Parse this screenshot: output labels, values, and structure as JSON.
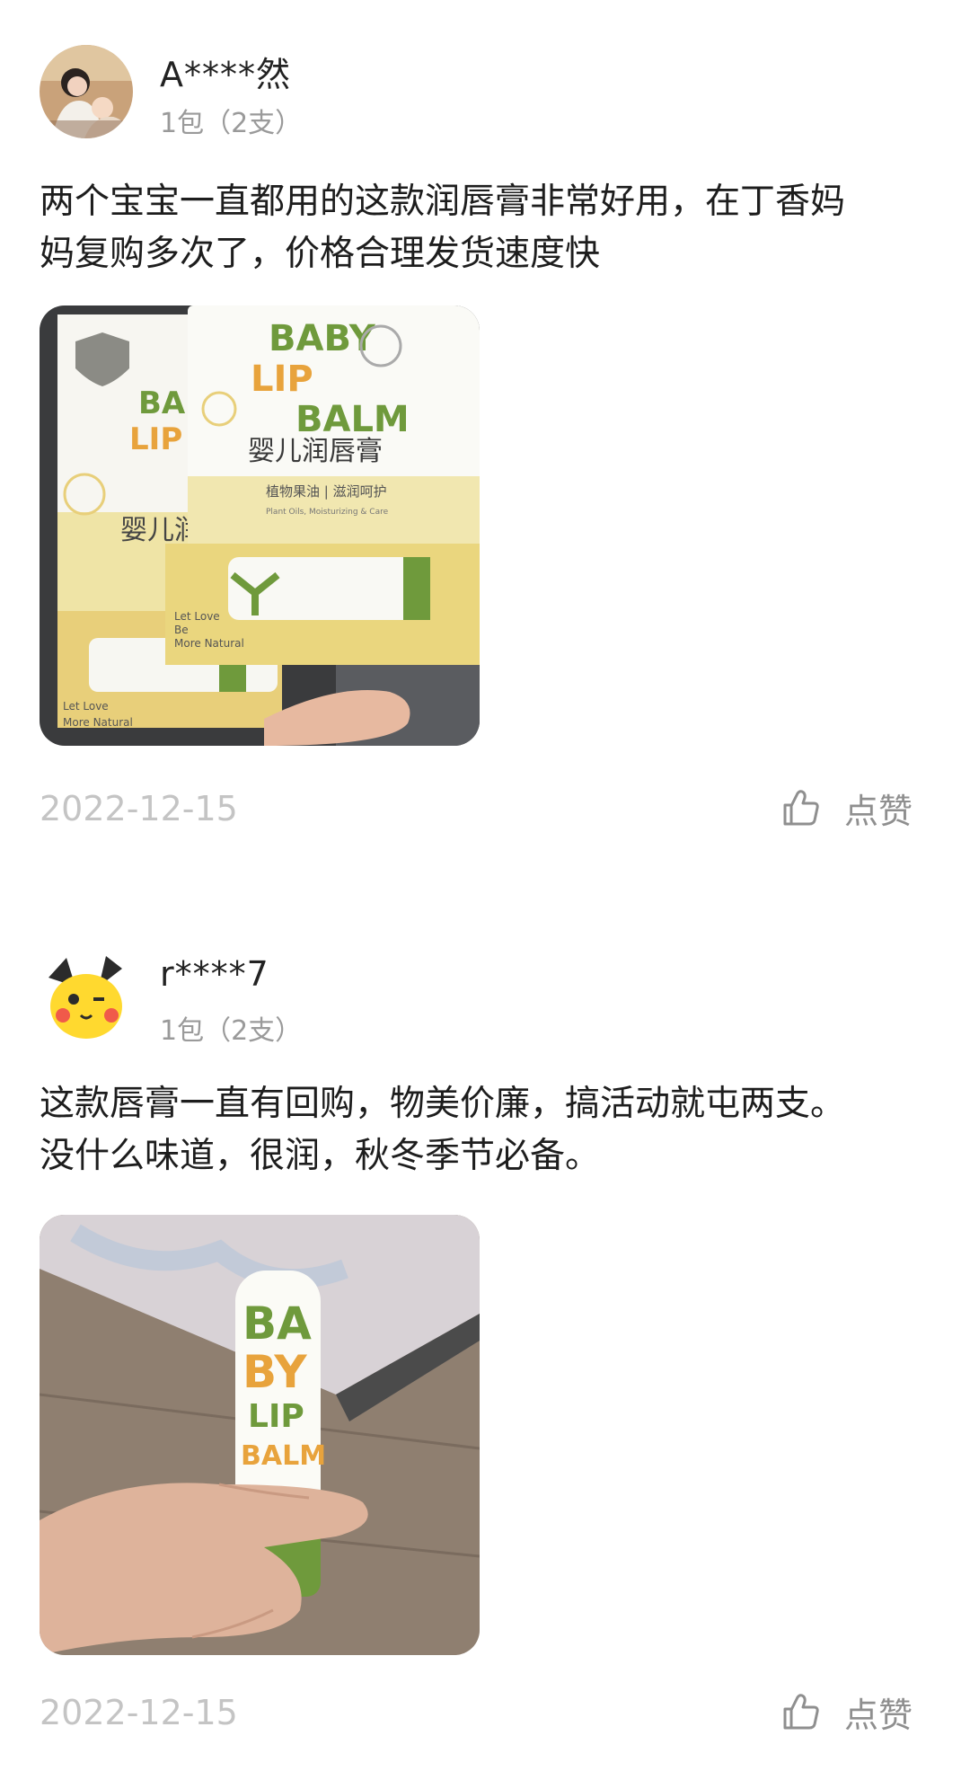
{
  "reviews": [
    {
      "username": "A****然",
      "variant": "1包（2支）",
      "text": "两个宝宝一直都用的这款润唇膏非常好用，在丁香妈\n妈复购多次了，价格合理发货速度快",
      "photo": {
        "box_brand_text": "婴儿润唇膏",
        "box_line1": "BABY",
        "box_line2": "LIP",
        "box_line3": "BALM",
        "box_subtitle": "植物果油 | 滋润呵护",
        "box_subtitle_en": "Plant Oils, Moisturizing & Care",
        "box_tagline": "Let Love Be More Natural"
      },
      "date": "2022-12-15",
      "like_label": "点赞"
    },
    {
      "username": "r****7",
      "variant": "1包（2支）",
      "text": "这款唇膏一直有回购，物美价廉，搞活动就屯两支。\n没什么味道，很润，秋冬季节必备。",
      "photo": {
        "stick_line1": "BA",
        "stick_line2": "BY",
        "stick_line3": "LIP",
        "stick_line4": "BALM"
      },
      "date": "2022-12-15",
      "like_label": "点赞"
    }
  ],
  "icons": {
    "like": "thumbs-up-icon"
  },
  "colors": {
    "date": "#c4c4c4",
    "variant": "#9a9a9a",
    "like_label": "#8f8f8f",
    "balm_green": "#6f9a3c",
    "balm_orange": "#e8a33c",
    "box_cream": "#f5ecb8"
  }
}
